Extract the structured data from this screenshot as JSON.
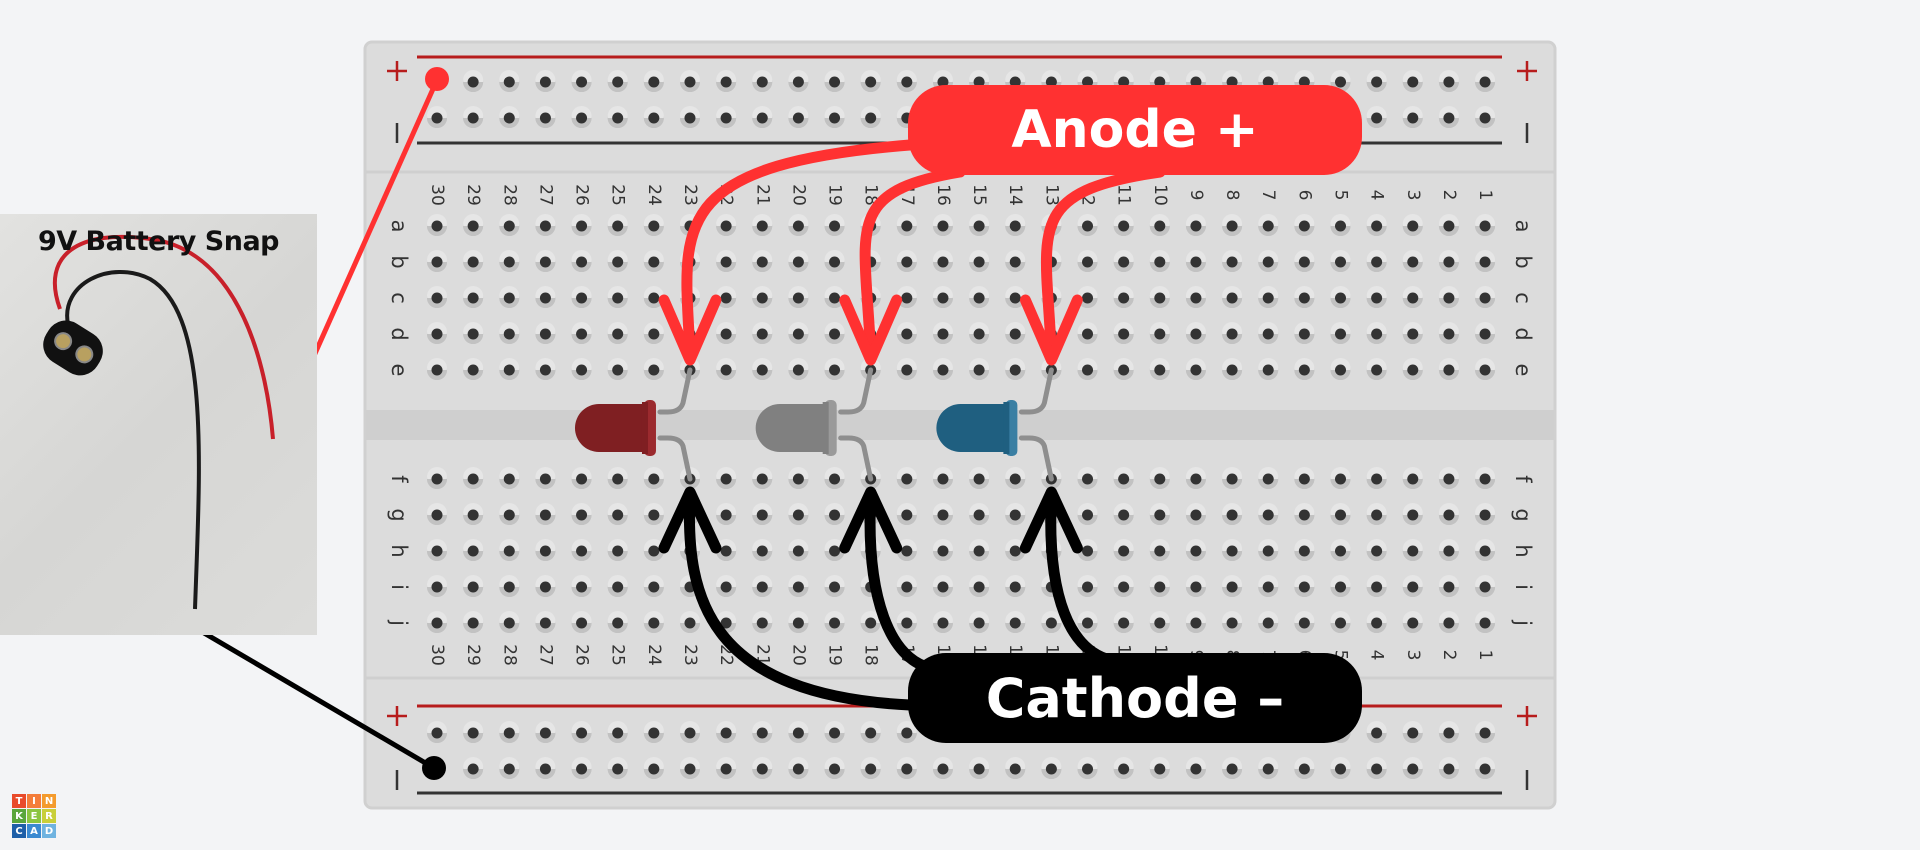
{
  "photo": {
    "title": "9V Battery Snap"
  },
  "callouts": {
    "anode": "Anode +",
    "cathode": "Cathode –"
  },
  "breadboard": {
    "columns": [
      30,
      29,
      28,
      27,
      26,
      25,
      24,
      23,
      22,
      21,
      20,
      19,
      18,
      17,
      16,
      15,
      14,
      13,
      12,
      11,
      10,
      9,
      8,
      7,
      6,
      5,
      4,
      3,
      2,
      1
    ],
    "rows_top": [
      "a",
      "b",
      "c",
      "d",
      "e"
    ],
    "rows_bottom": [
      "f",
      "g",
      "h",
      "i",
      "j"
    ],
    "rail_plus": "+",
    "rail_minus": "–"
  },
  "leds": [
    {
      "color_name": "red",
      "color": "#7f1f22",
      "rim": "#9b2a2e",
      "column": 23
    },
    {
      "color_name": "gray",
      "color": "#808080",
      "rim": "#9a9a9a",
      "column": 18
    },
    {
      "color_name": "blue",
      "color": "#1f5f80",
      "rim": "#3a7fa3",
      "column": 13
    }
  ],
  "wires": {
    "positive_color": "#ff3131",
    "negative_color": "#000000"
  },
  "logo": {
    "letters": [
      "T",
      "I",
      "N",
      "K",
      "E",
      "R",
      "C",
      "A",
      "D"
    ],
    "colors": [
      "#e94b2b",
      "#f47d3a",
      "#f49b2d",
      "#5aa63b",
      "#8cc540",
      "#c9cf3a",
      "#1e5fa8",
      "#3b8ad1",
      "#6fb3e0"
    ]
  }
}
